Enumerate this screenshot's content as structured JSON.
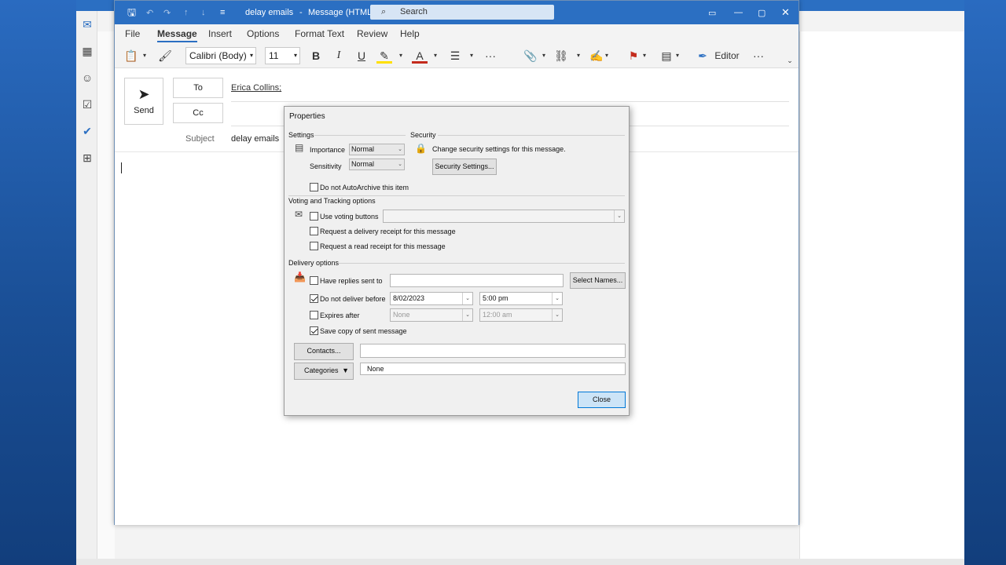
{
  "titlebar": {
    "subject": "delay emails",
    "separator": "-",
    "doc_type": "Message (HTML)",
    "search_placeholder": "Search"
  },
  "ribbon_tabs": [
    "File",
    "Message",
    "Insert",
    "Options",
    "Format Text",
    "Review",
    "Help"
  ],
  "active_tab": "Message",
  "ribbon": {
    "font": "Calibri (Body)",
    "size": "11",
    "editor": "Editor"
  },
  "compose": {
    "send": "Send",
    "to_label": "To",
    "cc_label": "Cc",
    "subject_label": "Subject",
    "to_value": "Erica Collins;",
    "subject_value": "delay emails"
  },
  "dialog": {
    "title": "Properties",
    "settings_header": "Settings",
    "importance_label": "Importance",
    "importance_value": "Normal",
    "sensitivity_label": "Sensitivity",
    "sensitivity_value": "Normal",
    "security_header": "Security",
    "security_text": "Change security settings for this message.",
    "security_button": "Security Settings...",
    "autoarchive": "Do not AutoArchive this item",
    "voting_header": "Voting and Tracking options",
    "use_voting": "Use voting buttons",
    "delivery_receipt": "Request a delivery receipt for this message",
    "read_receipt": "Request a read receipt for this message",
    "delivery_header": "Delivery options",
    "have_replies": "Have replies sent to",
    "select_names": "Select Names...",
    "do_not_deliver": "Do not deliver before",
    "deliver_date": "8/02/2023",
    "deliver_time": "5:00 pm",
    "expires_after": "Expires after",
    "expires_date": "None",
    "expires_time": "12:00 am",
    "save_copy": "Save copy of sent message",
    "contacts": "Contacts...",
    "categories": "Categories",
    "categories_value": "None",
    "close": "Close"
  },
  "colors": {
    "accent": "#2b6fc2",
    "flag": "#c42b1c"
  }
}
